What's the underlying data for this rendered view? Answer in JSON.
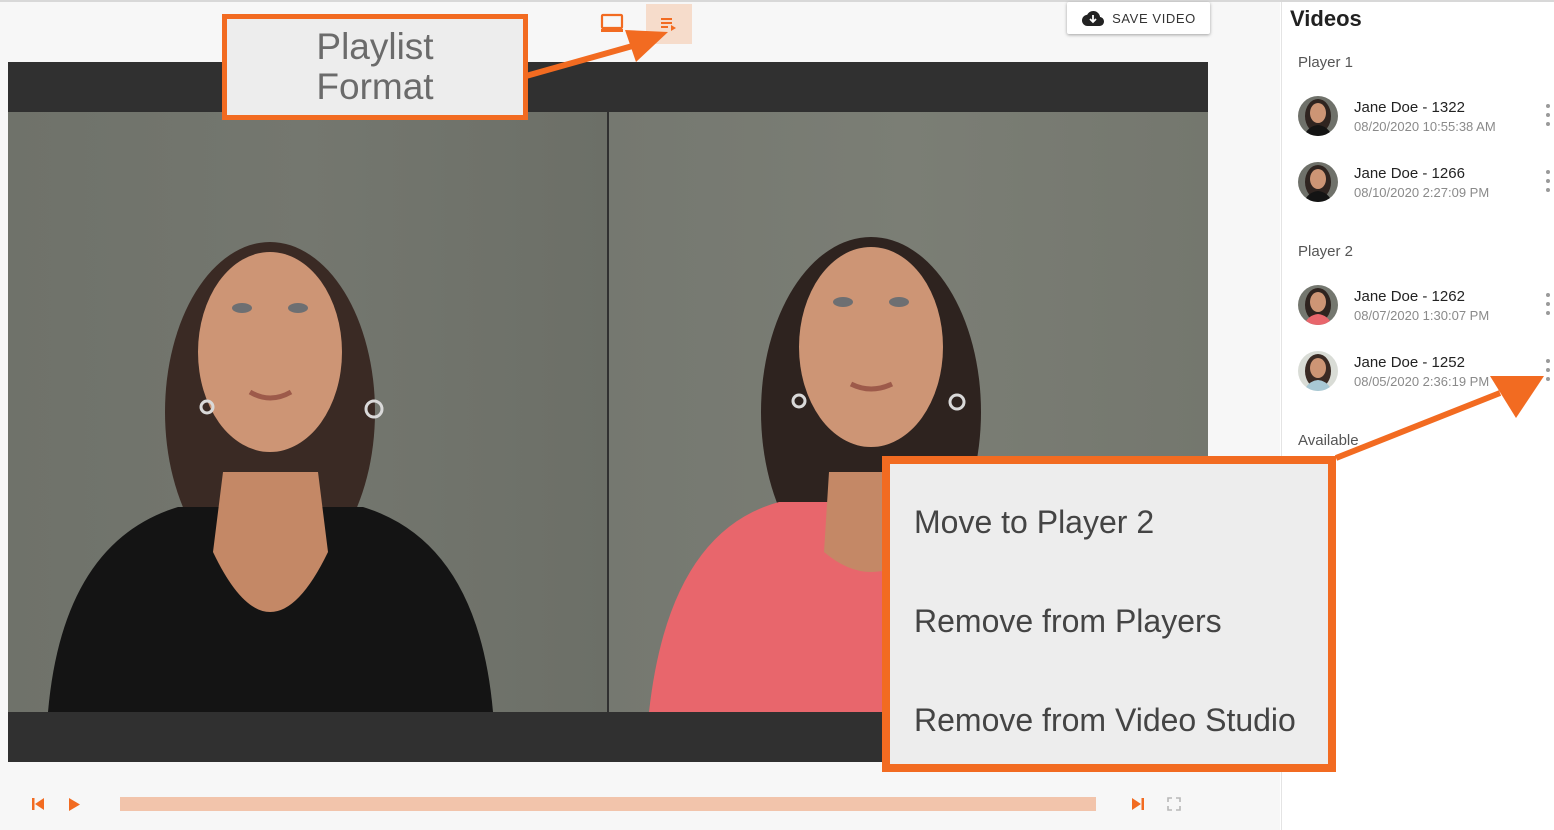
{
  "toolbar": {
    "save_label": "SAVE VIDEO",
    "view_icons": [
      "screen-icon",
      "playlist-icon"
    ],
    "active_view": "playlist"
  },
  "callouts": {
    "playlist_format_line1": "Playlist",
    "playlist_format_line2": "Format"
  },
  "context_menu": {
    "items": [
      "Move to Player 2",
      "Remove from Players",
      "Remove from Video Studio"
    ]
  },
  "sidebar": {
    "title": "Videos",
    "sections": {
      "player1": {
        "label": "Player 1",
        "items": [
          {
            "name": "Jane Doe - 1322",
            "date": "08/20/2020 10:55:38 AM"
          },
          {
            "name": "Jane Doe - 1266",
            "date": "08/10/2020 2:27:09 PM"
          }
        ]
      },
      "player2": {
        "label": "Player 2",
        "items": [
          {
            "name": "Jane Doe - 1262",
            "date": "08/07/2020 1:30:07 PM"
          },
          {
            "name": "Jane Doe - 1252",
            "date": "08/05/2020 2:36:19 PM"
          }
        ]
      },
      "available": {
        "label": "Available"
      }
    }
  },
  "colors": {
    "accent": "#f26b21",
    "progress_bar": "#f2c4ab",
    "active_view_bg": "#f6dccb",
    "stage_bg": "#303030"
  },
  "player_controls": {
    "icons": [
      "skip-previous-icon",
      "play-icon",
      "skip-next-icon",
      "fullscreen-icon"
    ]
  }
}
